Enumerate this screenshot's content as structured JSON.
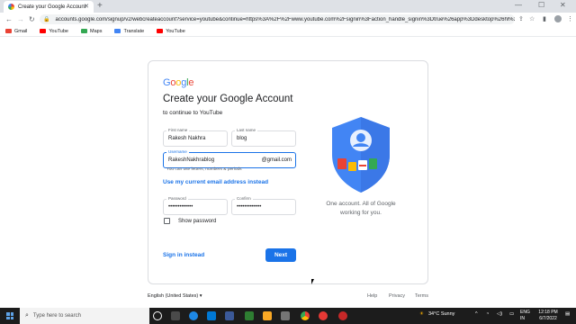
{
  "browser": {
    "tab_title": "Create your Google Account",
    "url": "accounts.google.com/signup/v2/webcreateaccount?service=youtube&continue=https%3A%2F%2Fwww.youtube.com%2Fsignin%3Faction_handle_signin%3Dtrue%26app%3Ddesktop%26hl%3Den...",
    "bookmarks": [
      {
        "label": "Gmail",
        "color": "#ea4335"
      },
      {
        "label": "YouTube",
        "color": "#ff0000"
      },
      {
        "label": "Maps",
        "color": "#34a853"
      },
      {
        "label": "Translate",
        "color": "#4285f4"
      },
      {
        "label": "YouTube",
        "color": "#ff0000"
      }
    ]
  },
  "form": {
    "logo_text": "Google",
    "heading": "Create your Google Account",
    "subheading": "to continue to YouTube",
    "first_name_label": "First name",
    "first_name_value": "Rakesh Nakhra",
    "last_name_label": "Last name",
    "last_name_value": "blog",
    "username_label": "Username",
    "username_value": "RakeshNakhrablog",
    "username_suffix": "@gmail.com",
    "username_hint": "You can use letters, numbers & periods",
    "use_current_email": "Use my current email address instead",
    "password_label": "Password",
    "password_value": "•••••••••••••",
    "confirm_label": "Confirm",
    "confirm_value": "•••••••••••••",
    "show_password_label": "Show password",
    "show_password_checked": false,
    "sign_in_instead": "Sign in instead",
    "next_label": "Next",
    "tagline": "One account. All of Google working for you.",
    "accent_color": "#1a73e8"
  },
  "footer": {
    "language": "English (United States)",
    "links": [
      "Help",
      "Privacy",
      "Terms"
    ]
  },
  "taskbar": {
    "search_placeholder": "Type here to search",
    "weather": "34°C  Sunny",
    "lang": "ENG",
    "region": "IN",
    "time": "12:18 PM",
    "date": "6/7/2022"
  }
}
